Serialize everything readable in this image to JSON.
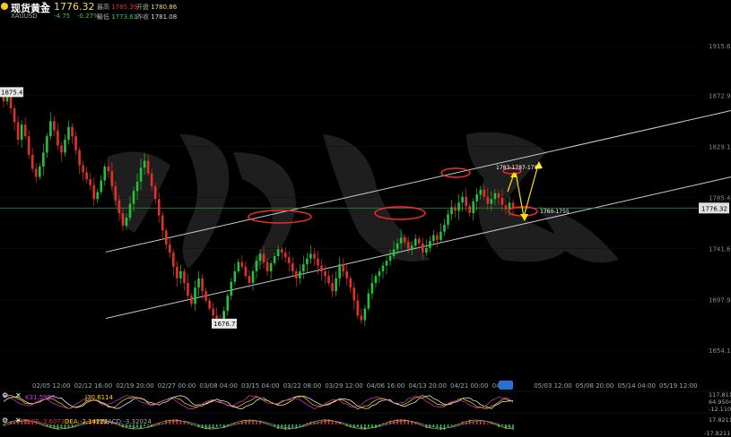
{
  "header": {
    "name": "现货黄金",
    "code": "XAUUSD",
    "price": "1776.32",
    "change": "-4.75",
    "change_pct": "-0.27%",
    "high_label": "最高",
    "high": "1785.39",
    "open_label": "开盘",
    "open": "1780.86",
    "low_label": "最低",
    "low": "1773.61",
    "prev_label": "昨收",
    "prev": "1781.08"
  },
  "colors": {
    "up": "#22c33a",
    "down": "#e0302b",
    "channel": "#c8ccd8",
    "current_line": "#1f8a2a",
    "annotation": "#ffe000",
    "ellipse": "#ff2a2a"
  },
  "chart_data": [
    {
      "type": "line",
      "title": "",
      "y_axis": {
        "ylim": [
          1632,
          1935
        ],
        "ticks": [
          "1915.66",
          "1872.91",
          "1829.17",
          "1785.43",
          "1741.68",
          "1697.94",
          "1654.19"
        ]
      },
      "x_axis_labels": [
        "02/05 12:00",
        "02/12 16:00",
        "02/19 20:00",
        "02/27 00:00",
        "03/08 04:00",
        "03/15 04:00",
        "03/22 08:00",
        "03/29 12:00",
        "04/06 16:00",
        "04/13 20:00",
        "04/21 00:00",
        "04/28",
        "05/03 12:00",
        "05/08 20:00",
        "05/14 04:00",
        "05/19 12:00"
      ],
      "current_price": 1776.32,
      "price_labels": [
        {
          "text": "1875.49",
          "value": 1875.49
        },
        {
          "text": "1676.71",
          "value": 1676.71
        }
      ],
      "annotations": [
        {
          "text": "1783-1787-1790",
          "value": 1788
        },
        {
          "text": "1760-1755",
          "value": 1758
        }
      ],
      "channel_lines": [
        {
          "name": "upper",
          "points": [
            [
              0.0,
              1718
            ],
            [
              1.0,
              1860
            ]
          ]
        },
        {
          "name": "lower",
          "points": [
            [
              0.0,
              1661
            ],
            [
              1.0,
              1803
            ]
          ]
        }
      ],
      "series": [
        {
          "values": [
            1868,
            1875,
            1862,
            1850,
            1835,
            1848,
            1838,
            1822,
            1810,
            1803,
            1812,
            1824,
            1838,
            1851,
            1843,
            1830,
            1824,
            1835,
            1846,
            1838,
            1826,
            1813,
            1807,
            1801,
            1796,
            1784,
            1790,
            1800,
            1812,
            1808,
            1795,
            1783,
            1772,
            1761,
            1768,
            1780,
            1791,
            1799,
            1811,
            1817,
            1806,
            1795,
            1784,
            1770,
            1757,
            1745,
            1738,
            1726,
            1716,
            1722,
            1712,
            1701,
            1694,
            1708,
            1716,
            1705,
            1697,
            1690,
            1684,
            1680,
            1678,
            1688,
            1701,
            1713,
            1722,
            1730,
            1726,
            1718,
            1712,
            1722,
            1731,
            1737,
            1730,
            1722,
            1729,
            1735,
            1741,
            1738,
            1734,
            1729,
            1722,
            1716,
            1722,
            1728,
            1733,
            1737,
            1733,
            1727,
            1722,
            1718,
            1712,
            1705,
            1716,
            1728,
            1722,
            1716,
            1708,
            1697,
            1684,
            1680,
            1690,
            1703,
            1712,
            1718,
            1722,
            1727,
            1731,
            1735,
            1741,
            1746,
            1751,
            1747,
            1741,
            1744,
            1750,
            1746,
            1738,
            1742,
            1748,
            1753,
            1749,
            1756,
            1762,
            1771,
            1777,
            1774,
            1781,
            1786,
            1778,
            1772,
            1782,
            1788,
            1792,
            1786,
            1780,
            1784,
            1789,
            1785,
            1779,
            1775,
            1781,
            1776
          ]
        }
      ]
    },
    {
      "type": "line",
      "title": "",
      "indicator": "KDJ",
      "labels": [
        "K31.5902",
        "J30.6114"
      ],
      "y_axis": {
        "ticks": [
          "117.811",
          "64.9504",
          "-12.1102"
        ]
      }
    },
    {
      "type": "bar",
      "title": "",
      "indicator": "MACD",
      "labels": [
        "DIFF:-3.60733",
        "DEA:-2.14221",
        "MACD:-3.32024"
      ],
      "y_axis": {
        "ticks": [
          "17.82117",
          "-17.82117"
        ]
      }
    }
  ]
}
